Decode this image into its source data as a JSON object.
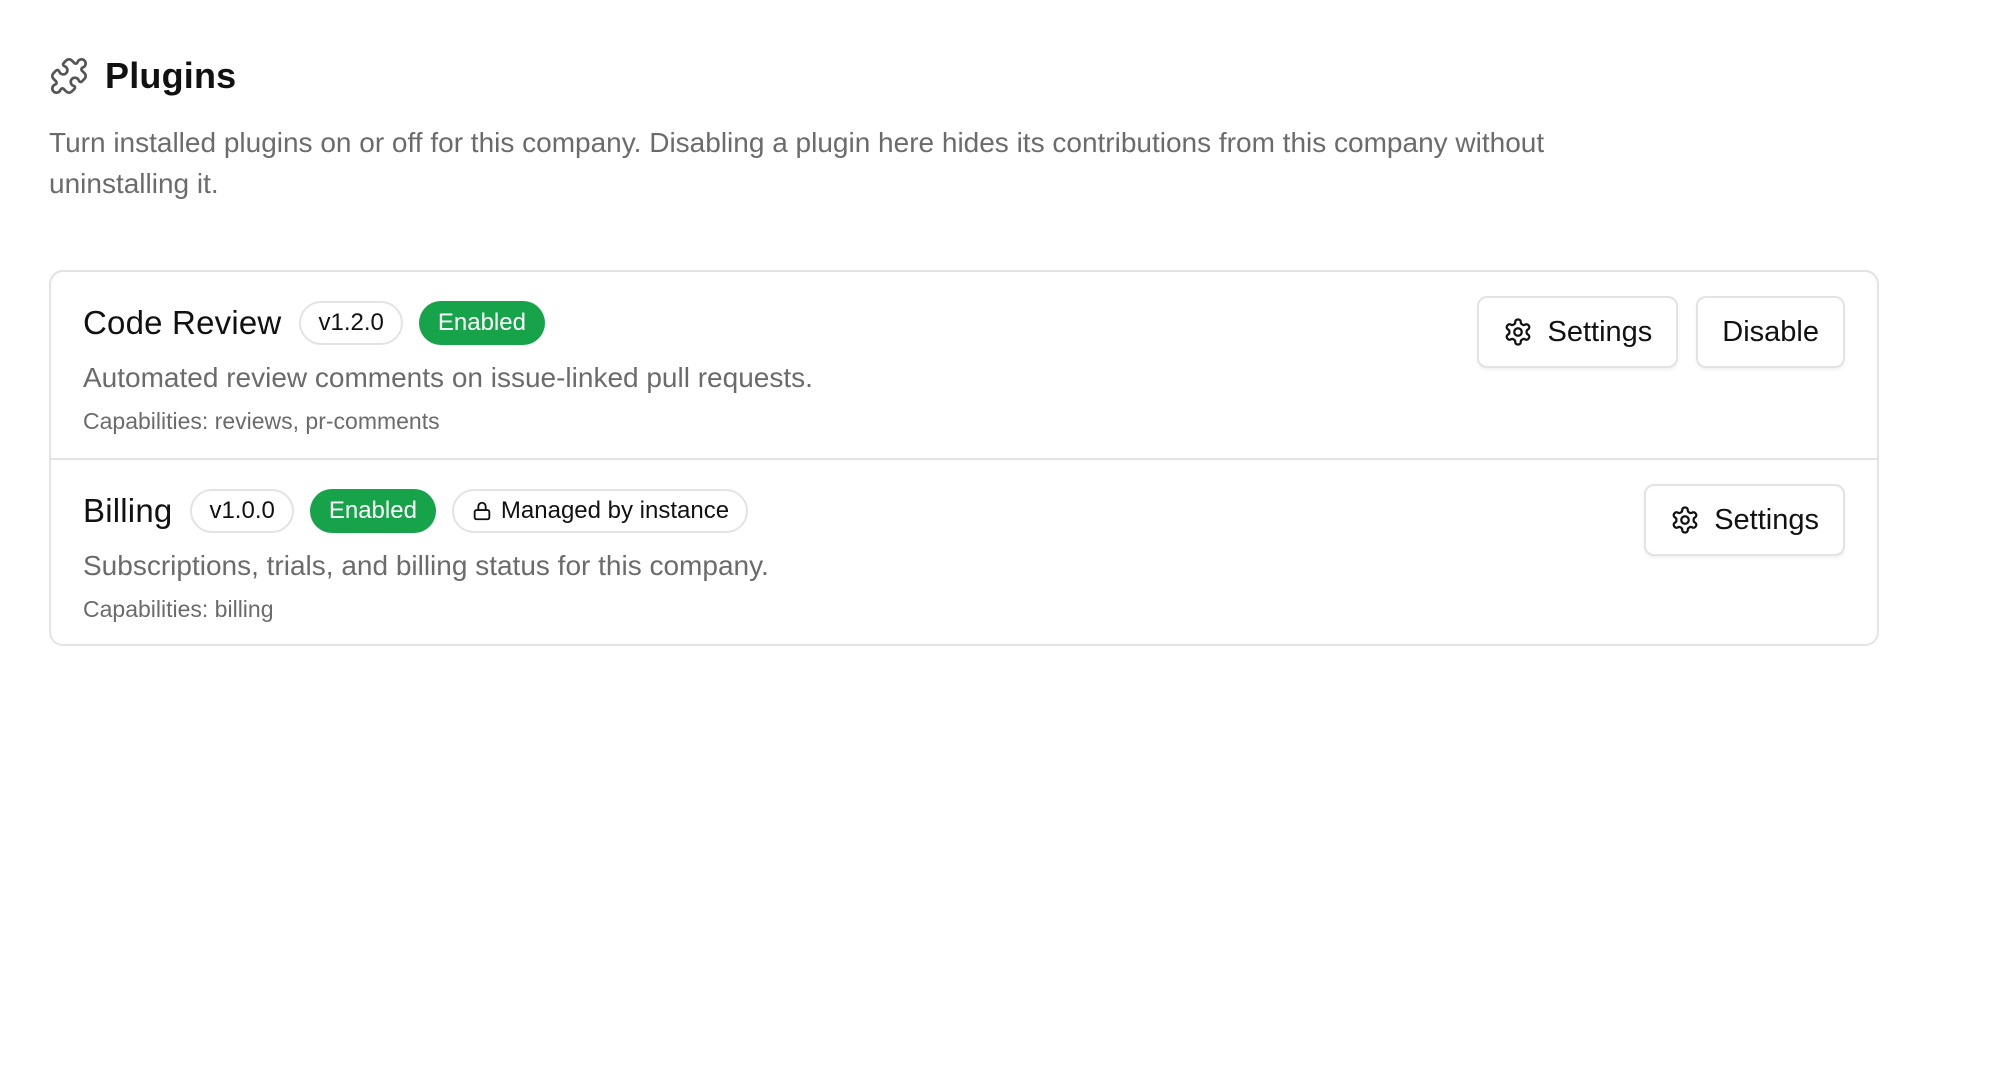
{
  "header": {
    "title": "Plugins",
    "icon": "puzzle-icon",
    "description": "Turn installed plugins on or off for this company. Disabling a plugin here hides its contributions from this company without uninstalling it."
  },
  "colors": {
    "enabled_badge": "#16a34a",
    "border": "#e3e3e3",
    "muted_text": "#6b6b6b"
  },
  "plugins": [
    {
      "name": "Code Review",
      "version": "v1.2.0",
      "status": "Enabled",
      "description": "Automated review comments on issue-linked pull requests.",
      "capabilities": "Capabilities: reviews, pr-comments",
      "settings_label": "Settings",
      "disable_label": "Disable"
    },
    {
      "name": "Billing",
      "version": "v1.0.0",
      "status": "Enabled",
      "managed_label": "Managed by instance",
      "description": "Subscriptions, trials, and billing status for this company.",
      "capabilities": "Capabilities: billing",
      "settings_label": "Settings"
    }
  ]
}
